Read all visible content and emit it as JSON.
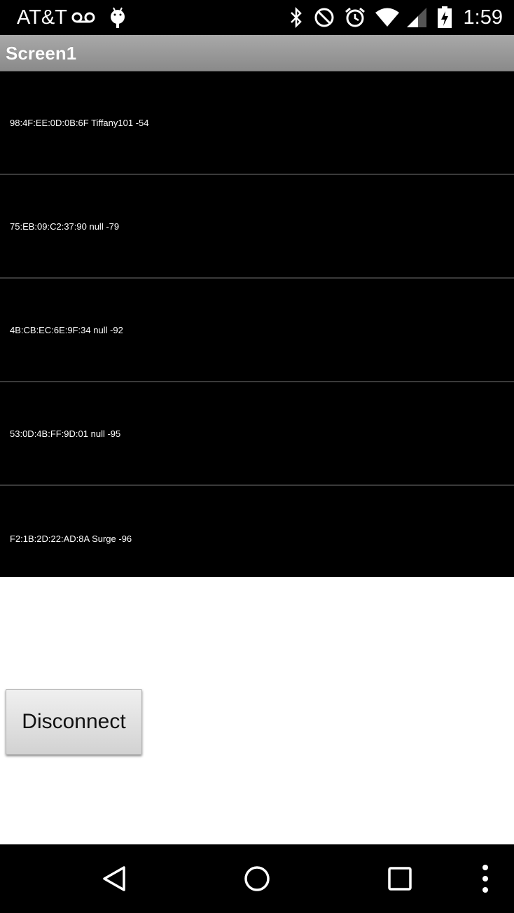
{
  "status_bar": {
    "carrier": "AT&T",
    "time": "1:59",
    "icons": [
      "voicemail-icon",
      "android-debug-icon",
      "bluetooth-icon",
      "do-not-disturb-icon",
      "alarm-icon",
      "wifi-icon",
      "cell-signal-icon",
      "battery-charging-icon"
    ]
  },
  "title_bar": {
    "title": "Screen1"
  },
  "device_list": {
    "items": [
      {
        "label": "98:4F:EE:0D:0B:6F Tiffany101 -54"
      },
      {
        "label": "75:EB:09:C2:37:90 null -79"
      },
      {
        "label": "4B:CB:EC:6E:9F:34 null -92"
      },
      {
        "label": "53:0D:4B:FF:9D:01 null -95"
      },
      {
        "label": "F2:1B:2D:22:AD:8A Surge -96"
      }
    ]
  },
  "actions": {
    "disconnect_label": "Disconnect"
  },
  "nav_bar": {
    "buttons": [
      "back-icon",
      "home-icon",
      "recents-icon",
      "overflow-menu-icon"
    ]
  },
  "colors": {
    "status_bar_bg": "#000000",
    "title_bar_bg": "#9a9a9a",
    "list_bg": "#000000",
    "list_text": "#ffffff",
    "content_bg": "#ffffff"
  }
}
